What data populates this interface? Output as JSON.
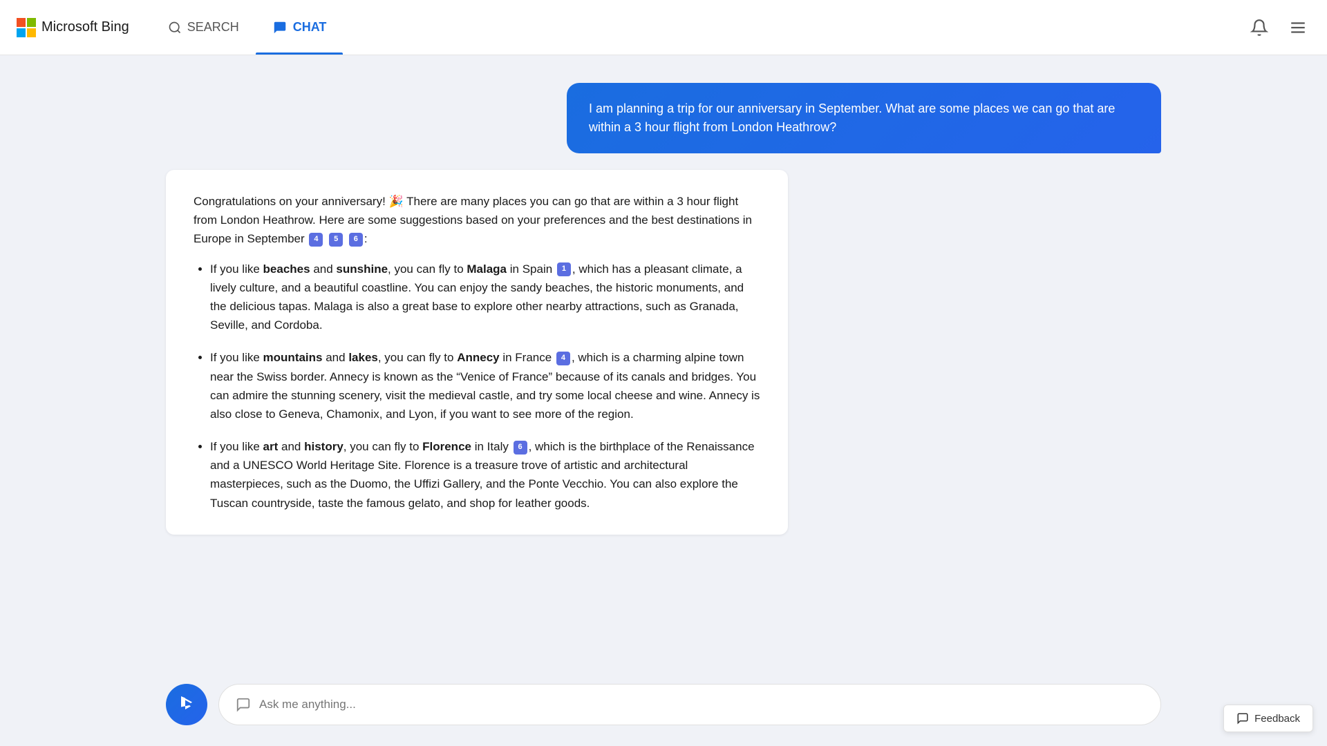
{
  "header": {
    "brand": "Microsoft Bing",
    "nav": [
      {
        "id": "search",
        "label": "SEARCH",
        "active": false
      },
      {
        "id": "chat",
        "label": "CHAT",
        "active": true
      }
    ]
  },
  "user_message": "I am planning a trip for our anniversary in September. What are some places we can go that are within a 3 hour flight from London Heathrow?",
  "ai_response": {
    "intro": "Congratulations on your anniversary! 🎉 There are many places you can go that are within a 3 hour flight from London Heathrow. Here are some suggestions based on your preferences and the best destinations in Europe in September",
    "intro_citations": [
      "4",
      "5",
      "6"
    ],
    "bullets": [
      {
        "text_before": "If you like ",
        "bold1": "beaches",
        "text_mid1": " and ",
        "bold2": "sunshine",
        "text_mid2": ", you can fly to ",
        "bold3": "Malaga",
        "text_after": " in Spain",
        "citation": "1",
        "rest": ", which has a pleasant climate, a lively culture, and a beautiful coastline. You can enjoy the sandy beaches, the historic monuments, and the delicious tapas. Malaga is also a great base to explore other nearby attractions, such as Granada, Seville, and Cordoba."
      },
      {
        "text_before": "If you like ",
        "bold1": "mountains",
        "text_mid1": " and ",
        "bold2": "lakes",
        "text_mid2": ", you can fly to ",
        "bold3": "Annecy",
        "text_after": " in France",
        "citation": "4",
        "rest": ", which is a charming alpine town near the Swiss border. Annecy is known as the “Venice of France” because of its canals and bridges. You can admire the stunning scenery, visit the medieval castle, and try some local cheese and wine. Annecy is also close to Geneva, Chamonix, and Lyon, if you want to see more of the region."
      },
      {
        "text_before": "If you like ",
        "bold1": "art",
        "text_mid1": " and ",
        "bold2": "history",
        "text_mid2": ", you can fly to ",
        "bold3": "Florence",
        "text_after": " in Italy",
        "citation": "6",
        "rest": ", which is the birthplace of the Renaissance and a UNESCO World Heritage Site. Florence is a treasure trove of artistic and architectural masterpieces, such as the Duomo, the Uffizi Gallery, and the Ponte Vecchio. You can also explore the Tuscan countryside, taste the famous gelato, and shop for leather goods."
      }
    ]
  },
  "input": {
    "placeholder": "Ask me anything..."
  },
  "feedback": {
    "label": "Feedback"
  }
}
